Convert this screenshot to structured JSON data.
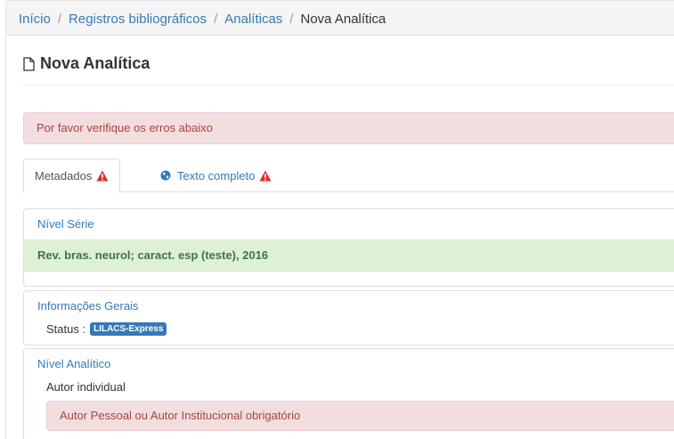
{
  "breadcrumb": {
    "items": [
      "Início",
      "Registros bibliográficos",
      "Analíticas"
    ],
    "separator": "/",
    "current": "Nova Analítica"
  },
  "page": {
    "title": "Nova Analítica",
    "title_icon": "file-icon"
  },
  "alert": {
    "message": "Por favor verifique os erros abaixo"
  },
  "tabs": {
    "metadados": {
      "label": "Metadados",
      "icon": "warning-icon"
    },
    "texto_completo": {
      "label": "Texto completo",
      "icon": "globe-icon",
      "status_icon": "warning-icon"
    }
  },
  "nivel_serie": {
    "title": "Nível Série",
    "value": "Rev. bras. neurol; caract. esp (teste), 2016"
  },
  "informacoes_gerais": {
    "title": "Informações Gerais",
    "status_label": "Status :",
    "status_badge": "LILACS-Express"
  },
  "nivel_analitico": {
    "title": "Nível Analítico",
    "field_label": "Autor individual",
    "error": "Autor Pessoal ou Autor Institucional obrigatório"
  },
  "colors": {
    "link": "#337ab7",
    "danger_bg": "#f2dede",
    "danger_text": "#a94442",
    "success_bg": "#dff0d8",
    "success_text": "#3c763d",
    "warning_icon": "#d9302b"
  }
}
